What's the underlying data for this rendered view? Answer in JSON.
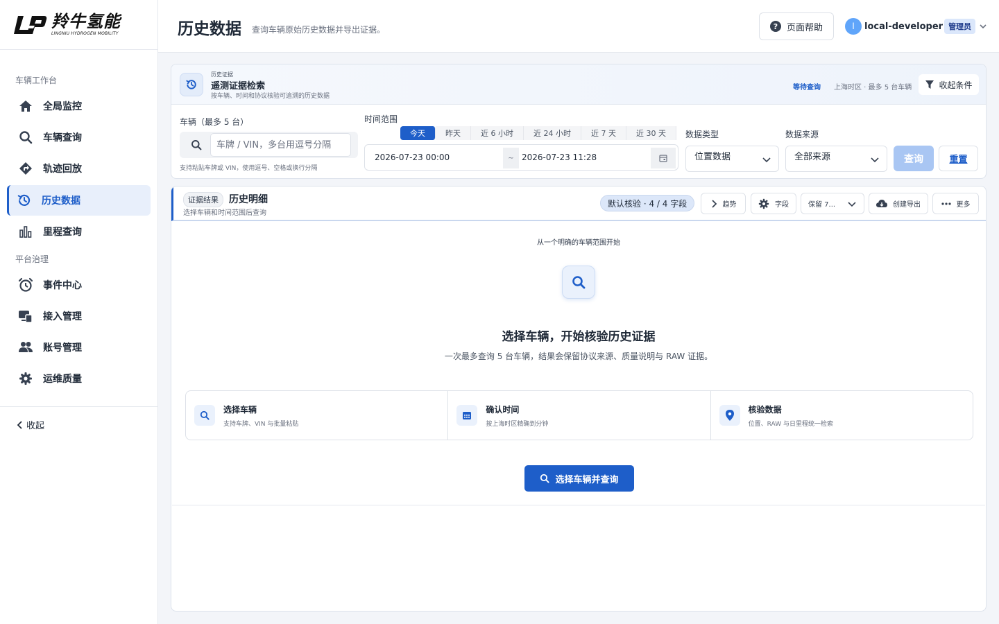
{
  "brand": {
    "name_cn": "羚牛氢能",
    "name_en": "LINGNIU HYDROGEN MOBILITY"
  },
  "sidebar": {
    "section_workbench": "车辆工作台",
    "section_governance": "平台治理",
    "items": [
      {
        "label": "全局监控",
        "icon": "home-icon"
      },
      {
        "label": "车辆查询",
        "icon": "search-icon"
      },
      {
        "label": "轨迹回放",
        "icon": "route-icon"
      },
      {
        "label": "历史数据",
        "icon": "history-icon",
        "active": true
      },
      {
        "label": "里程查询",
        "icon": "bar-chart-icon"
      },
      {
        "label": "事件中心",
        "icon": "alarm-icon"
      },
      {
        "label": "接入管理",
        "icon": "device-icon"
      },
      {
        "label": "账号管理",
        "icon": "users-icon"
      },
      {
        "label": "运维质量",
        "icon": "gear-icon"
      }
    ],
    "collapse_label": "收起"
  },
  "header": {
    "title": "历史数据",
    "subtitle": "查询车辆原始历史数据并导出证据。",
    "help_label": "页面帮助",
    "user_initial": "l",
    "username": "local-developer",
    "role": "管理员"
  },
  "search": {
    "eyebrow": "历史证据",
    "title": "遥测证据检索",
    "desc": "按车辆、时间和协议核验可追溯的历史数据",
    "status": "等待查询",
    "zone_note": "上海时区 · 最多 5 台车辆",
    "filter_toggle": "收起条件",
    "vehicle_label": "车辆（最多 5 台）",
    "vehicle_placeholder": "车牌 / VIN，多台用逗号分隔",
    "vehicle_hint": "支持粘贴车牌或 VIN，使用逗号、空格或换行分隔",
    "time_label": "时间范围",
    "quick_ranges": [
      "今天",
      "昨天",
      "近 6 小时",
      "近 24 小时",
      "近 7 天",
      "近 30 天"
    ],
    "quick_active": "今天",
    "start_time": "2026-07-23 00:00",
    "range_sep": "~",
    "end_time": "2026-07-23 11:28",
    "data_type_label": "数据类型",
    "data_type_value": "位置数据",
    "source_label": "数据来源",
    "source_value": "全部来源",
    "query_label": "查询",
    "reset_label": "重置"
  },
  "results": {
    "chip": "证据结果",
    "title": "历史明细",
    "subtitle": "选择车辆和时间范围后查询",
    "verify_chip": "默认核验 · 4 / 4 字段",
    "trend_label": "趋势",
    "fields_label": "字段",
    "retain_label": "保留 7...",
    "export_label": "创建导出",
    "more_label": "更多",
    "empty": {
      "eyebrow": "从一个明确的车辆范围开始",
      "title": "选择车辆，开始核验历史证据",
      "desc": "一次最多查询 5 台车辆，结果会保留协议来源、质量说明与 RAW 证据。",
      "steps": [
        {
          "title": "选择车辆",
          "desc": "支持车牌、VIN 与批量粘贴",
          "icon": "search-icon"
        },
        {
          "title": "确认时间",
          "desc": "按上海时区精确到分钟",
          "icon": "calendar-icon"
        },
        {
          "title": "核验数据",
          "desc": "位置、RAW 与日里程统一检索",
          "icon": "location-pin-icon"
        }
      ],
      "cta": "选择车辆并查询"
    }
  },
  "colors": {
    "accent": "#1e5ec9",
    "active_bg": "#e8effb",
    "query_disabled": "#a9c6f3"
  }
}
